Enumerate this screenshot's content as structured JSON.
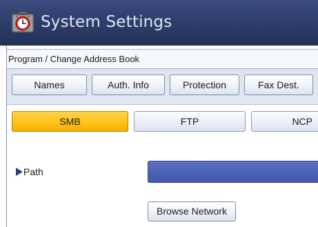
{
  "window": {
    "title": "System Settings",
    "icon": "settings-clock-icon"
  },
  "breadcrumb": "Program / Change Address Book",
  "tabs": [
    {
      "label": "Names"
    },
    {
      "label": "Auth. Info"
    },
    {
      "label": "Protection"
    },
    {
      "label": "Fax Dest."
    }
  ],
  "modes": [
    {
      "label": "SMB",
      "selected": true
    },
    {
      "label": "FTP",
      "selected": false
    },
    {
      "label": "NCP",
      "selected": false
    }
  ],
  "path": {
    "label": "Path",
    "value": ""
  },
  "browse_button": "Browse Network",
  "colors": {
    "title_bar": "#2f3e6d",
    "selected_mode": "#ffc21a",
    "path_field": "#4d63b5"
  }
}
